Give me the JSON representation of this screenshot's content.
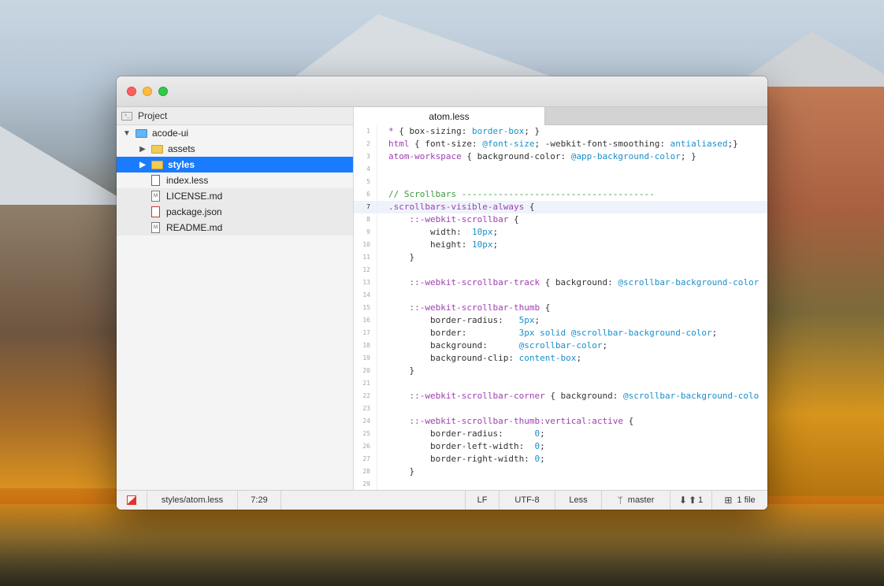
{
  "sidebar": {
    "title": "Project",
    "items": [
      {
        "label": "acode-ui",
        "kind": "folder",
        "open": true,
        "depth": 0
      },
      {
        "label": "assets",
        "kind": "folder",
        "depth": 1
      },
      {
        "label": "styles",
        "kind": "folder",
        "depth": 1,
        "selected": true
      },
      {
        "label": "index.less",
        "kind": "file",
        "depth": 1
      },
      {
        "label": "LICENSE.md",
        "kind": "file",
        "depth": 1
      },
      {
        "label": "package.json",
        "kind": "file",
        "depth": 1
      },
      {
        "label": "README.md",
        "kind": "file",
        "depth": 1
      }
    ]
  },
  "tabs": [
    {
      "label": "atom.less",
      "active": true
    }
  ],
  "code": {
    "active_line": 7,
    "lines": [
      {
        "n": "1",
        "t": [
          [
            "sel",
            "* "
          ],
          [
            "",
            "{ box-sizing: "
          ],
          [
            "val",
            "border-box"
          ],
          [
            "",
            "; }"
          ]
        ]
      },
      {
        "n": "2",
        "t": [
          [
            "sel",
            "html "
          ],
          [
            "",
            "{ font-size: "
          ],
          [
            "val",
            "@font-size"
          ],
          [
            "",
            "; -webkit-font-smoothing: "
          ],
          [
            "val",
            "antialiased"
          ],
          [
            "",
            ";}"
          ]
        ]
      },
      {
        "n": "3",
        "t": [
          [
            "sel",
            "atom-workspace "
          ],
          [
            "",
            "{ background-color: "
          ],
          [
            "val",
            "@app-background-color"
          ],
          [
            "",
            "; }"
          ]
        ]
      },
      {
        "n": "4",
        "t": []
      },
      {
        "n": "5",
        "t": []
      },
      {
        "n": "6",
        "t": [
          [
            "cmt",
            "// Scrollbars -------------------------------------"
          ]
        ]
      },
      {
        "n": "7",
        "t": [
          [
            "sel",
            ".scrollbars-visible-always "
          ],
          [
            "",
            "{"
          ]
        ]
      },
      {
        "n": "8",
        "t": [
          [
            "",
            "    "
          ],
          [
            "sel",
            "::-webkit-scrollbar "
          ],
          [
            "",
            "{"
          ]
        ]
      },
      {
        "n": "9",
        "t": [
          [
            "",
            "        width:  "
          ],
          [
            "val",
            "10px"
          ],
          [
            "",
            ";"
          ]
        ]
      },
      {
        "n": "10",
        "t": [
          [
            "",
            "        height: "
          ],
          [
            "val",
            "10px"
          ],
          [
            "",
            ";"
          ]
        ]
      },
      {
        "n": "11",
        "t": [
          [
            "",
            "    }"
          ]
        ]
      },
      {
        "n": "12",
        "t": []
      },
      {
        "n": "13",
        "t": [
          [
            "",
            "    "
          ],
          [
            "sel",
            "::-webkit-scrollbar-track "
          ],
          [
            "",
            "{ background: "
          ],
          [
            "val",
            "@scrollbar-background-color"
          ]
        ]
      },
      {
        "n": "14",
        "t": []
      },
      {
        "n": "15",
        "t": [
          [
            "",
            "    "
          ],
          [
            "sel",
            "::-webkit-scrollbar-thumb "
          ],
          [
            "",
            "{"
          ]
        ]
      },
      {
        "n": "16",
        "t": [
          [
            "",
            "        border-radius:   "
          ],
          [
            "val",
            "5px"
          ],
          [
            "",
            ";"
          ]
        ]
      },
      {
        "n": "17",
        "t": [
          [
            "",
            "        border:          "
          ],
          [
            "val",
            "3px solid @scrollbar-background-color"
          ],
          [
            "",
            ";"
          ]
        ]
      },
      {
        "n": "18",
        "t": [
          [
            "",
            "        background:      "
          ],
          [
            "val",
            "@scrollbar-color"
          ],
          [
            "",
            ";"
          ]
        ]
      },
      {
        "n": "19",
        "t": [
          [
            "",
            "        background-clip: "
          ],
          [
            "val",
            "content-box"
          ],
          [
            "",
            ";"
          ]
        ]
      },
      {
        "n": "20",
        "t": [
          [
            "",
            "    }"
          ]
        ]
      },
      {
        "n": "21",
        "t": []
      },
      {
        "n": "22",
        "t": [
          [
            "",
            "    "
          ],
          [
            "sel",
            "::-webkit-scrollbar-corner "
          ],
          [
            "",
            "{ background: "
          ],
          [
            "val",
            "@scrollbar-background-colo"
          ]
        ]
      },
      {
        "n": "23",
        "t": []
      },
      {
        "n": "24",
        "t": [
          [
            "",
            "    "
          ],
          [
            "sel",
            "::-webkit-scrollbar-thumb:vertical:active "
          ],
          [
            "",
            "{"
          ]
        ]
      },
      {
        "n": "25",
        "t": [
          [
            "",
            "        border-radius:      "
          ],
          [
            "val",
            "0"
          ],
          [
            "",
            ";"
          ]
        ]
      },
      {
        "n": "26",
        "t": [
          [
            "",
            "        border-left-width:  "
          ],
          [
            "val",
            "0"
          ],
          [
            "",
            ";"
          ]
        ]
      },
      {
        "n": "27",
        "t": [
          [
            "",
            "        border-right-width: "
          ],
          [
            "val",
            "0"
          ],
          [
            "",
            ";"
          ]
        ]
      },
      {
        "n": "28",
        "t": [
          [
            "",
            "    }"
          ]
        ]
      },
      {
        "n": "29",
        "t": []
      }
    ]
  },
  "status": {
    "file_path": "styles/atom.less",
    "cursor": "7:29",
    "line_ending": "LF",
    "encoding": "UTF-8",
    "grammar": "Less",
    "branch": "master",
    "fetch_count": "1",
    "changed_files": "1 file"
  },
  "colors": {
    "selection": "#1a7bff",
    "selector": "#9f3fb0",
    "value": "#1a8fc9",
    "comment": "#3a9b3a"
  }
}
